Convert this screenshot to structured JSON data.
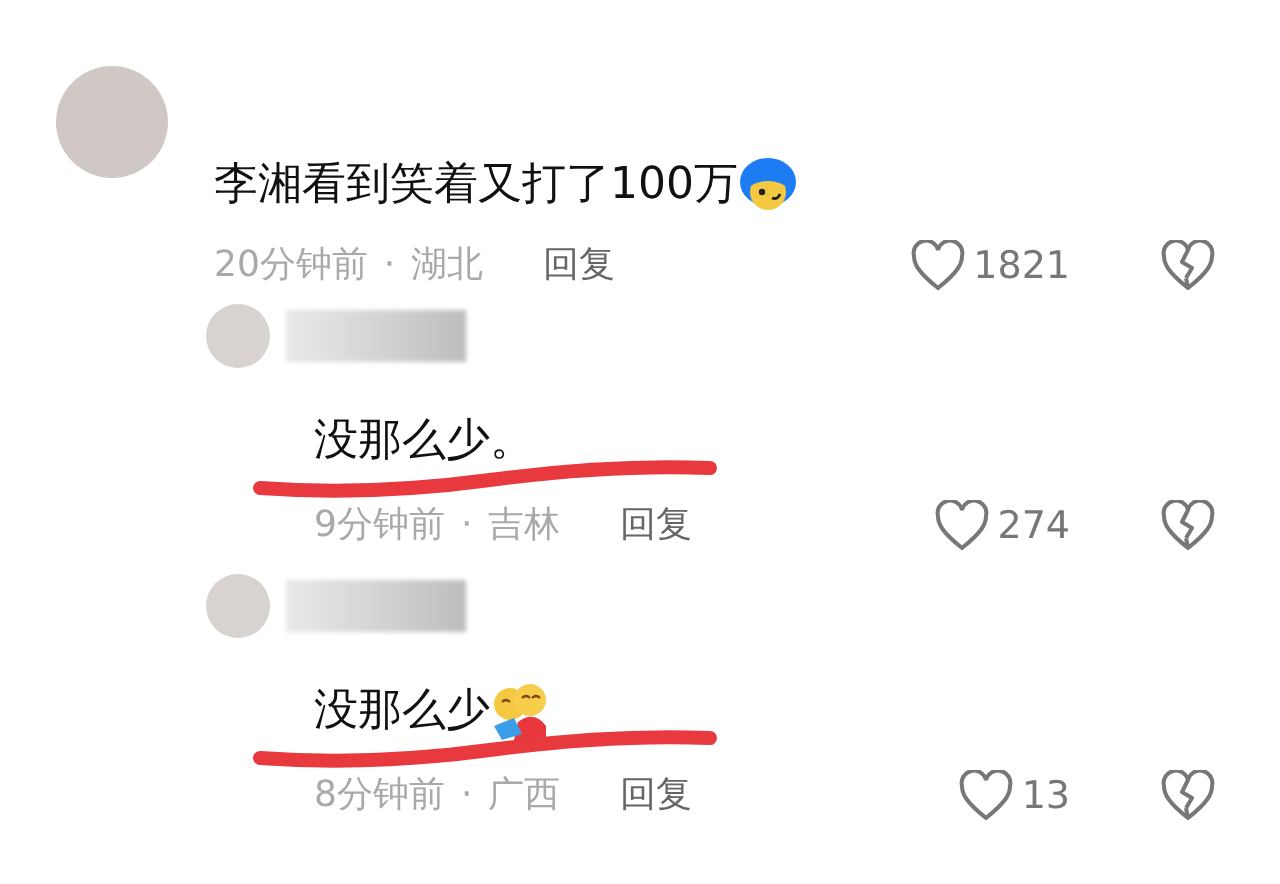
{
  "comments": [
    {
      "kind": "top",
      "text": "李湘看到笑着又打了100万",
      "emoji": {
        "kind": "blue-hair"
      },
      "underlined": false,
      "time": "20分钟前",
      "separator": "·",
      "location": "湖北",
      "reply": "回复",
      "likes": "1821"
    },
    {
      "kind": "reply",
      "text": "没那么少。",
      "underlined": true,
      "time": "9分钟前",
      "separator": "·",
      "location": "吉林",
      "reply": "回复",
      "likes": "274"
    },
    {
      "kind": "reply",
      "text": "没那么少",
      "emoji": {
        "kind": "hug"
      },
      "underlined": true,
      "time": "8分钟前",
      "separator": "·",
      "location": "广西",
      "reply": "回复",
      "likes": "13"
    }
  ]
}
